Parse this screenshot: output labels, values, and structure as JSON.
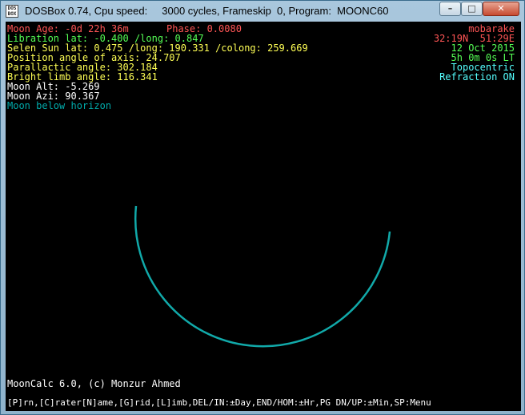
{
  "window": {
    "title": "DOSBox 0.74, Cpu speed:     3000 cycles, Frameskip  0, Program:  MOONC60",
    "icon_text_top": "DOS",
    "icon_text_bottom": "BOX",
    "minimize_glyph": "–",
    "maximize_glyph": "□",
    "close_glyph": "✕",
    "icons": [
      "dosbox-icon",
      "minimize-icon",
      "maximize-icon",
      "close-icon"
    ]
  },
  "info": {
    "moon_age": "Moon Age: -0d 22h 36m",
    "phase": "Phase: 0.0080",
    "location_name": "mobarake",
    "libration": "Libration lat: -0.400 /long: 0.847",
    "coords": "32:19N  51:29E",
    "selen_sun": "Selen Sun lat: 0.475 /long: 190.331 /colong: 259.669",
    "date": "12 Oct 2015",
    "position_angle": "Position angle of axis: 24.707",
    "time": "5h 0m 0s LT",
    "parallactic": "Parallactic angle: 302.184",
    "topocentric": "Topocentric",
    "bright_limb": "Bright limb angle: 116.341",
    "refraction": "Refraction ON",
    "moon_alt": "Moon Alt: -5.269",
    "moon_azi": "Moon Azi: 90.367",
    "below_horizon": "Moon below horizon"
  },
  "footer": {
    "credit": "MoonCalc 6.0, (c) Monzur Ahmed",
    "keys": "[P]rn,[C]rater[N]ame,[G]rid,[L]imb,DEL/IN:±Day,END/HOM:±Hr,PG DN/UP:±Min,SP:Menu"
  },
  "colors": {
    "red": "#ff5555",
    "green": "#55ff55",
    "yellow": "#ffff55",
    "white": "#ffffff",
    "cyan": "#00aaaa",
    "light_cyan": "#55ffff",
    "moon_limb": "#11a9a9"
  }
}
